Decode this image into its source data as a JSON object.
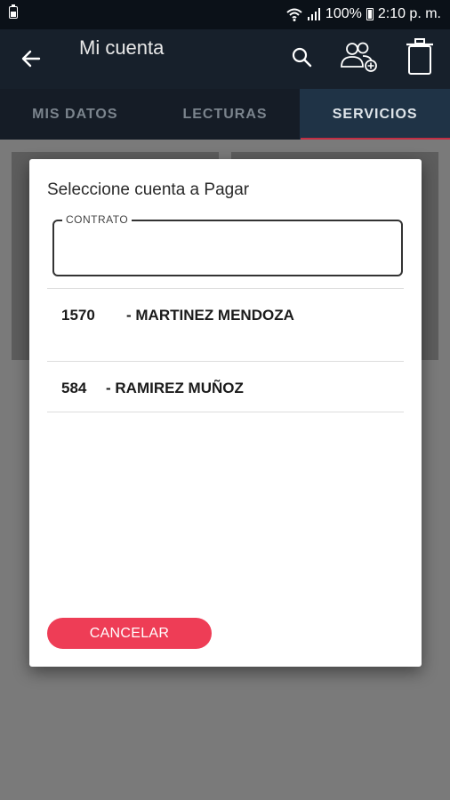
{
  "status": {
    "battery": "100%",
    "time": "2:10 p. m."
  },
  "appbar": {
    "title": "Mi cuenta"
  },
  "tabs": [
    "MIS DATOS",
    "LECTURAS",
    "SERVICIOS"
  ],
  "dialog": {
    "title": "Seleccione cuenta a Pagar",
    "field_label": "CONTRATO",
    "field_value": "",
    "accounts": [
      {
        "number": "1570",
        "name": "- MARTINEZ MENDOZA"
      },
      {
        "number": "584",
        "name": "- RAMIREZ MUÑOZ"
      }
    ],
    "cancel_label": "CANCELAR"
  },
  "colors": {
    "accent": "#ee3d56",
    "appbar": "#17202b",
    "active_tab": "#1f3346"
  }
}
